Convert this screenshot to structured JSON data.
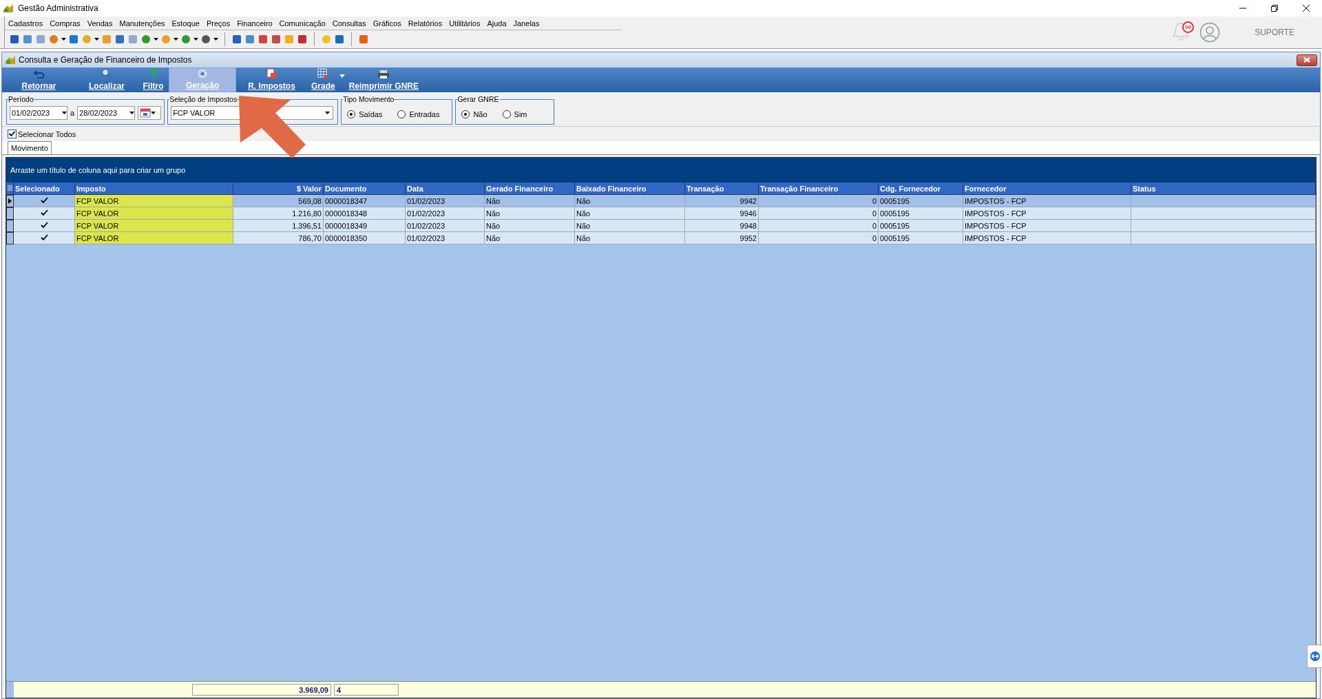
{
  "window": {
    "title": "Gestão Administrativa"
  },
  "menu": [
    "Cadastros",
    "Compras",
    "Vendas",
    "Manutenções",
    "Estoque",
    "Preços",
    "Financeiro",
    "Comunicação",
    "Consultas",
    "Gráficos",
    "Relatórios",
    "Utilitários",
    "Ajuda",
    "Janelas"
  ],
  "header_right": {
    "notification_count": "00",
    "user_label": "SUPORTE"
  },
  "child_window": {
    "title": "Consulta e Geração de Financeiro de Impostos"
  },
  "toolbar": [
    {
      "label": "Retornar",
      "kind": "undo",
      "selected": false
    },
    {
      "label": "Localizar",
      "kind": "search",
      "selected": false
    },
    {
      "label": "Filtro",
      "kind": "filter",
      "selected": false
    },
    {
      "label": "Geração",
      "kind": "gear",
      "selected": true
    },
    {
      "label": "R. Impostos",
      "kind": "report",
      "selected": false
    },
    {
      "label": "Grade",
      "kind": "grid",
      "selected": false
    },
    {
      "label": "Reimprimir GNRE",
      "kind": "printer",
      "selected": false
    }
  ],
  "filters": {
    "periodo": {
      "legend": "Período",
      "from": "01/02/2023",
      "separator": "a",
      "to": "28/02/2023"
    },
    "selecao": {
      "legend": "Seleção de Impostos",
      "value": "FCP VALOR"
    },
    "tipo_movimento": {
      "legend": "Tipo Movimento",
      "options": [
        {
          "label": "Saídas",
          "selected": true
        },
        {
          "label": "Entradas",
          "selected": false
        }
      ]
    },
    "gerar_gnre": {
      "legend": "Gerar GNRE",
      "options": [
        {
          "label": "Não",
          "selected": true
        },
        {
          "label": "Sim",
          "selected": false
        }
      ]
    }
  },
  "select_all": {
    "label": "Selecionar Todos",
    "checked": true
  },
  "tabs": [
    {
      "label": "Movimento",
      "selected": true
    }
  ],
  "grid": {
    "group_hint": "Arraste um título de coluna aqui para criar um grupo",
    "columns": [
      "Selecionado",
      "Imposto",
      "$ Valor",
      "Documento",
      "Data",
      "Gerado Financeiro",
      "Baixado Financeiro",
      "Transação",
      "Transação Financeiro",
      "Cdg. Fornecedor",
      "Fornecedor",
      "Status"
    ],
    "rows": [
      {
        "selected": true,
        "checked": true,
        "highlighted": true,
        "imposto": "FCP VALOR",
        "valor": "569,08",
        "documento": "0000018347",
        "data": "01/02/2023",
        "gerado": "Não",
        "baixado": "Não",
        "transacao": "9942",
        "transacao_financeiro": "0",
        "cdg_fornecedor": "0005195",
        "fornecedor": "IMPOSTOS - FCP"
      },
      {
        "selected": false,
        "checked": true,
        "highlighted": true,
        "imposto": "FCP VALOR",
        "valor": "1.216,80",
        "documento": "0000018348",
        "data": "01/02/2023",
        "gerado": "Não",
        "baixado": "Não",
        "transacao": "9946",
        "transacao_financeiro": "0",
        "cdg_fornecedor": "0005195",
        "fornecedor": "IMPOSTOS - FCP"
      },
      {
        "selected": false,
        "checked": true,
        "highlighted": true,
        "imposto": "FCP VALOR",
        "valor": "1.396,51",
        "documento": "0000018349",
        "data": "01/02/2023",
        "gerado": "Não",
        "baixado": "Não",
        "transacao": "9948",
        "transacao_financeiro": "0",
        "cdg_fornecedor": "0005195",
        "fornecedor": "IMPOSTOS - FCP"
      },
      {
        "selected": false,
        "checked": true,
        "highlighted": true,
        "imposto": "FCP VALOR",
        "valor": "786,70",
        "documento": "0000018350",
        "data": "01/02/2023",
        "gerado": "Não",
        "baixado": "Não",
        "transacao": "9952",
        "transacao_financeiro": "0",
        "cdg_fornecedor": "0005195",
        "fornecedor": "IMPOSTOS - FCP"
      }
    ],
    "totals": {
      "valor": "3.969,09",
      "count": "4"
    }
  }
}
